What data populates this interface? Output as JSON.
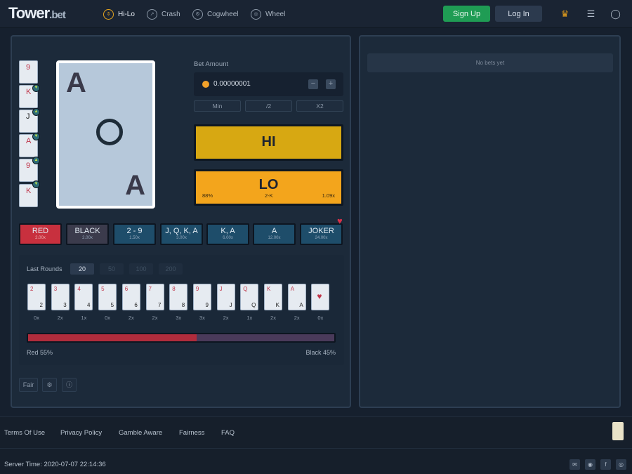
{
  "header": {
    "logo": "Tower",
    "logo_suffix": ".bet",
    "nav": [
      {
        "label": "Hi-Lo",
        "icon": "hilo-icon"
      },
      {
        "label": "Crash",
        "icon": "crash-icon"
      },
      {
        "label": "Cogwheel",
        "icon": "cogwheel-icon"
      },
      {
        "label": "Wheel",
        "icon": "wheel-icon"
      }
    ],
    "signup_label": "Sign Up",
    "login_label": "Log In"
  },
  "game": {
    "history_cards": [
      "9",
      "K",
      "J",
      "A",
      "9",
      "K"
    ],
    "current_card": "A",
    "bet_amount_label": "Bet Amount",
    "bet_amount_value": "0.00000001",
    "quick": [
      "Min",
      "/2",
      "X2"
    ],
    "hi_label": "HI",
    "lo_label": "LO",
    "lo_chance": "88%",
    "lo_range": "2-K",
    "lo_multiplier": "1.09x",
    "options": [
      {
        "label": "RED",
        "mult": "2.00x"
      },
      {
        "label": "BLACK",
        "mult": "2.00x"
      },
      {
        "label": "2 - 9",
        "mult": "1.50x"
      },
      {
        "label": "J, Q, K, A",
        "mult": "3.00x"
      },
      {
        "label": "K, A",
        "mult": "6.00x"
      },
      {
        "label": "A",
        "mult": "12.00x"
      },
      {
        "label": "JOKER",
        "mult": "24.00x"
      }
    ],
    "last_rounds_label": "Last Rounds",
    "round_counts": [
      "20",
      "50",
      "100",
      "200"
    ],
    "round_cards": [
      "2",
      "3",
      "4",
      "5",
      "6",
      "7",
      "8",
      "9",
      "J",
      "Q",
      "K",
      "A",
      "Joker"
    ],
    "round_mults": [
      "0x",
      "2x",
      "1x",
      "0x",
      "2x",
      "2x",
      "3x",
      "3x",
      "2x",
      "1x",
      "2x",
      "2x",
      "0x"
    ],
    "red_percent": 55,
    "red_label": "Red 55%",
    "black_label": "Black 45%",
    "fair_label": "Fair"
  },
  "bets": {
    "empty_text": "No bets yet"
  },
  "footer": {
    "links": [
      "Terms Of Use",
      "Privacy Policy",
      "Gamble Aware",
      "Fairness",
      "FAQ"
    ],
    "server_time": "Server Time: 2020-07-07 22:14:36"
  },
  "colors": {
    "accent": "#e5a41e",
    "signup": "#1f9c54",
    "hi": "#d7a812",
    "lo": "#f3a51c",
    "red": "#c8303e"
  }
}
